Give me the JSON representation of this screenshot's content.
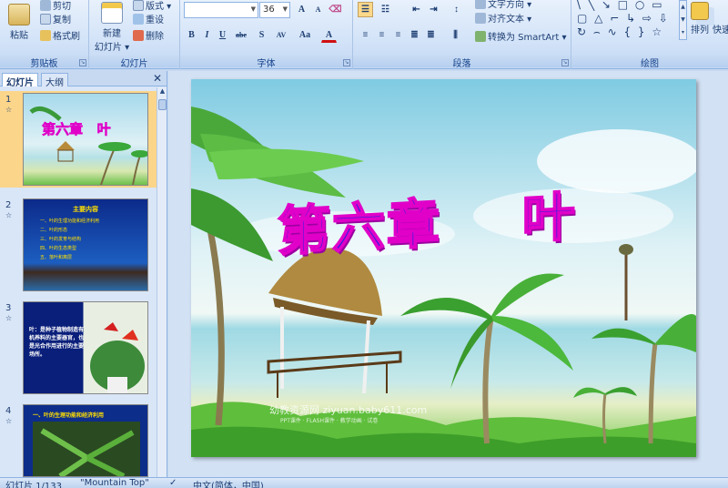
{
  "ribbon": {
    "clipboard": {
      "label": "剪贴板",
      "paste": "粘贴",
      "cut": "剪切",
      "copy": "复制",
      "format_painter": "格式刷"
    },
    "slides": {
      "label": "幻灯片",
      "new_slide": "新建",
      "new_slide2": "幻灯片 ▾",
      "layout": "版式 ▾",
      "reset": "重设",
      "delete": "删除"
    },
    "font": {
      "label": "字体",
      "font_name": "",
      "font_size": "36",
      "bold": "B",
      "italic": "I",
      "underline": "U",
      "strike": "abe",
      "shadow": "S",
      "spacing": "AV",
      "case": "Aa",
      "color": "A"
    },
    "paragraph": {
      "label": "段落",
      "text_direction": "文字方向 ▾",
      "align_text": "对齐文本 ▾",
      "smartart": "转换为 SmartArt ▾"
    },
    "drawing": {
      "label": "绘图",
      "arrange": "排列",
      "quick_styles": "快速"
    }
  },
  "pane": {
    "tabs": [
      "幻灯片",
      "大纲"
    ],
    "slides": [
      {
        "num": "1",
        "title": "第六章   叶"
      },
      {
        "num": "2",
        "heading": "主要内容",
        "items": [
          "一、叶的生理功能和经济利用",
          "二、叶的形态",
          "三、叶的发育与结构",
          "四、叶的生态类型",
          "五、落叶和离层"
        ]
      },
      {
        "num": "3",
        "text": "叶：是种子植物制造有机养料的主要器官，也是光合作用进行的主要场所。"
      },
      {
        "num": "4",
        "heading": "一、叶的生理功能和经济利用"
      }
    ]
  },
  "slide": {
    "title": "第六章    叶",
    "watermark": "幼教资源网 ziyuan.baby611.com",
    "watermark_small": "PPT课件 · FLASH课件 · 教学动画 · 试卷"
  },
  "status": {
    "slide_count": "幻灯片 1/133",
    "theme": "\"Mountain Top\"",
    "language": "中文(简体，中国)"
  },
  "colors": {
    "title_fill": "#2b20e0",
    "title_outline": "#e000c8",
    "selected_thumb": "#fbd58a"
  }
}
